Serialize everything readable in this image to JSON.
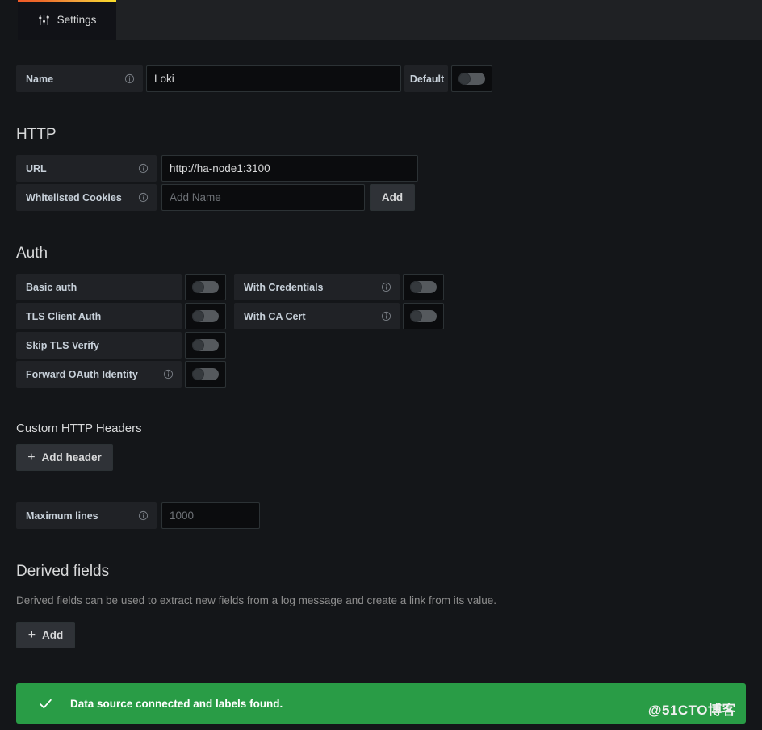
{
  "tabs": [
    {
      "label": "Settings",
      "icon": "sliders-icon",
      "active": true
    }
  ],
  "name_row": {
    "label": "Name",
    "info_icon": "info-circle-icon",
    "value": "Loki",
    "default_label": "Default",
    "default_toggle": "off"
  },
  "http": {
    "title": "HTTP",
    "url": {
      "label": "URL",
      "info_icon": "info-circle-icon",
      "value": "http://ha-node1:3100"
    },
    "cookies": {
      "label": "Whitelisted Cookies",
      "info_icon": "info-circle-icon",
      "placeholder": "Add Name",
      "value": "",
      "add_label": "Add"
    }
  },
  "auth": {
    "title": "Auth",
    "left": [
      {
        "label": "Basic auth",
        "info_icon": null,
        "toggle": "off"
      },
      {
        "label": "TLS Client Auth",
        "info_icon": null,
        "toggle": "off"
      },
      {
        "label": "Skip TLS Verify",
        "info_icon": null,
        "toggle": "off"
      },
      {
        "label": "Forward OAuth Identity",
        "info_icon": "info-circle-icon",
        "toggle": "off"
      }
    ],
    "right": [
      {
        "label": "With Credentials",
        "info_icon": "info-circle-icon",
        "toggle": "off"
      },
      {
        "label": "With CA Cert",
        "info_icon": "info-circle-icon",
        "toggle": "off"
      }
    ]
  },
  "custom_headers": {
    "title": "Custom HTTP Headers",
    "add_label": "Add header"
  },
  "max_lines": {
    "label": "Maximum lines",
    "info_icon": "info-circle-icon",
    "placeholder": "1000",
    "value": ""
  },
  "derived_fields": {
    "title": "Derived fields",
    "description": "Derived fields can be used to extract new fields from a log message and create a link from its value.",
    "add_label": "Add"
  },
  "alert": {
    "icon": "check-icon",
    "message": "Data source connected and labels found.",
    "color": "#299c46"
  },
  "watermark": {
    "text": "@51CTO博客"
  }
}
